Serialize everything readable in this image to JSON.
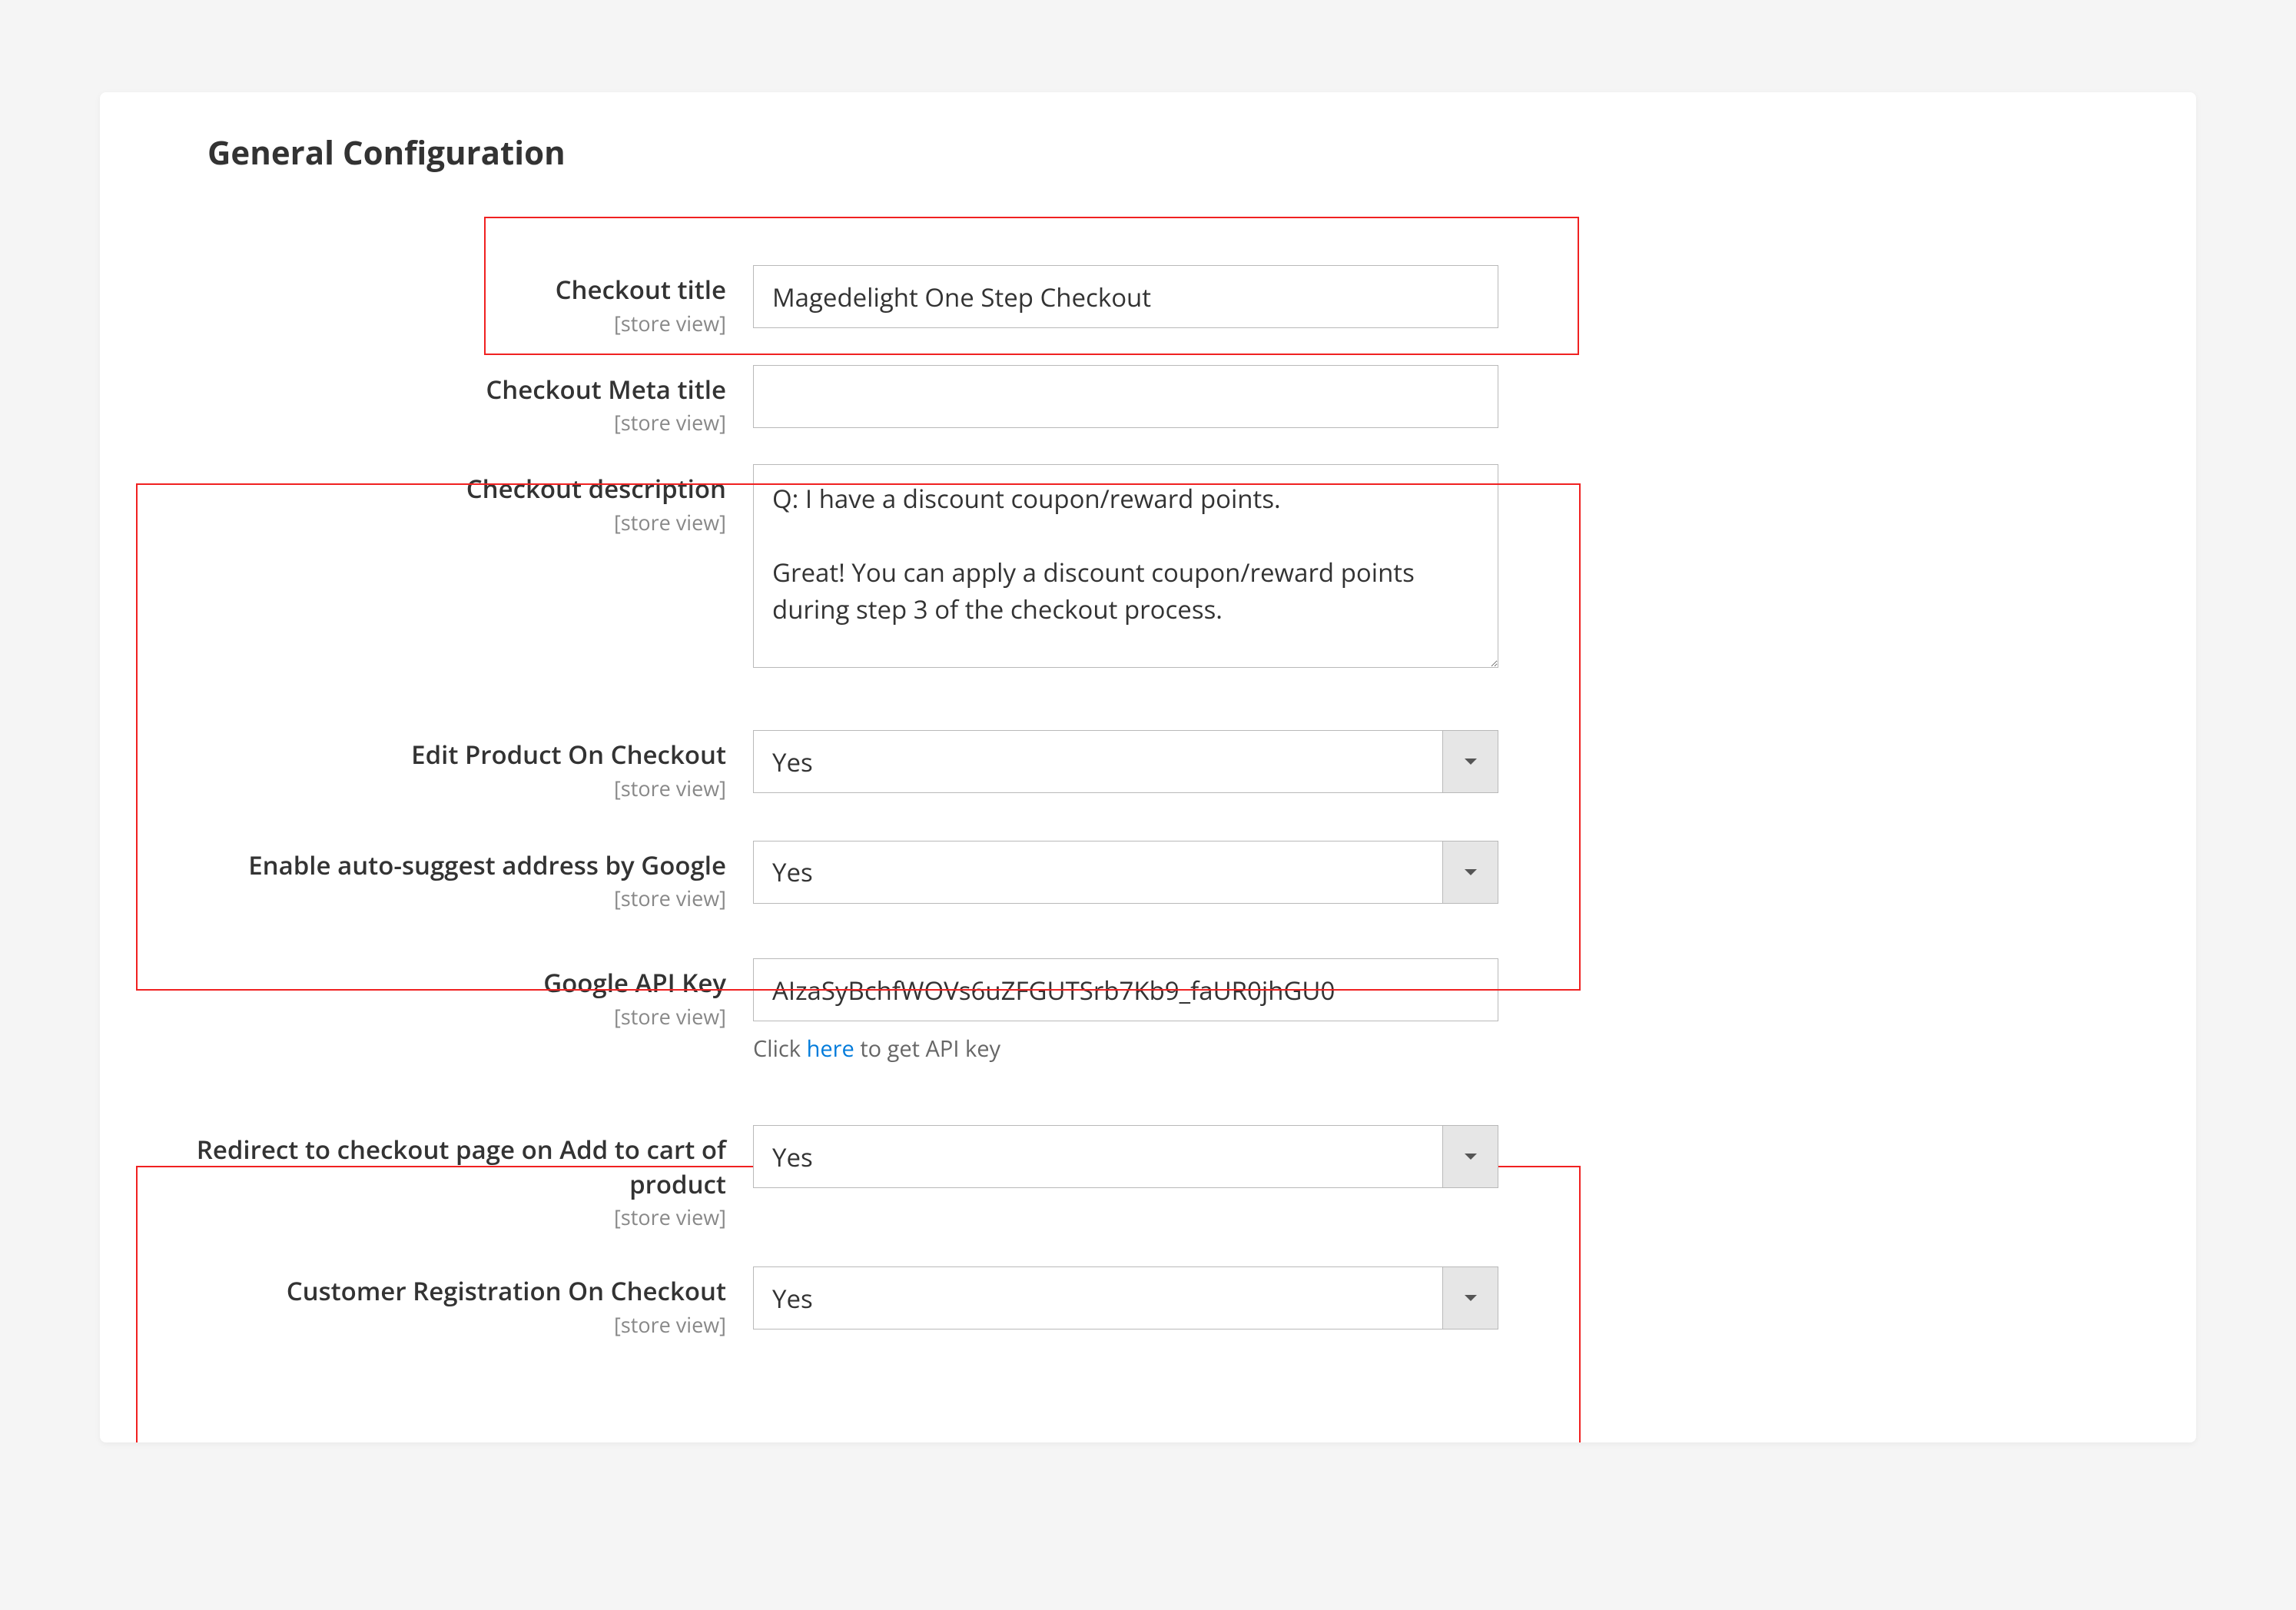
{
  "section_title": "General Configuration",
  "scope_label": "[store view]",
  "fields": {
    "checkout_title": {
      "label": "Checkout title",
      "value": "Magedelight One Step Checkout"
    },
    "checkout_meta_title": {
      "label": "Checkout Meta title",
      "value": ""
    },
    "checkout_description": {
      "label": "Checkout description",
      "value": "Q: I have a discount coupon/reward points.\n\nGreat! You can apply a discount coupon/reward points during step 3 of the checkout process."
    },
    "edit_product": {
      "label": "Edit Product On Checkout",
      "value": "Yes"
    },
    "auto_suggest": {
      "label": "Enable auto-suggest address by Google",
      "value": "Yes"
    },
    "google_api_key": {
      "label": "Google API Key",
      "value": "AIzaSyBchfWOVs6uZFGUTSrb7Kb9_faUR0jhGU0",
      "hint_pre": "Click ",
      "hint_link": "here",
      "hint_post": " to get API key"
    },
    "redirect_checkout": {
      "label": "Redirect to checkout page on Add to cart of product",
      "value": "Yes"
    },
    "customer_registration": {
      "label": "Customer Registration On Checkout",
      "value": "Yes"
    }
  }
}
